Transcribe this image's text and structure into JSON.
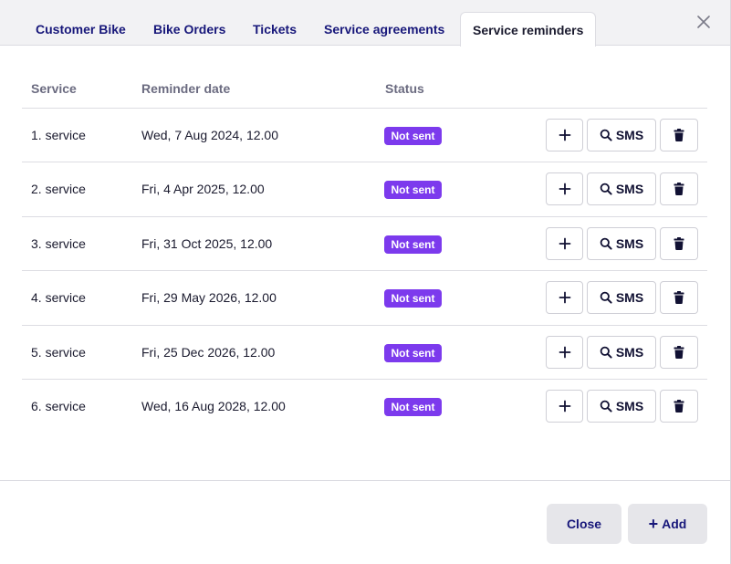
{
  "tabs": [
    {
      "label": "Customer Bike"
    },
    {
      "label": "Bike Orders"
    },
    {
      "label": "Tickets"
    },
    {
      "label": "Service agreements"
    },
    {
      "label": "Service reminders"
    }
  ],
  "active_tab": "Service reminders",
  "table": {
    "headers": {
      "service": "Service",
      "reminder_date": "Reminder date",
      "status": "Status"
    },
    "rows": [
      {
        "service": "1. service",
        "date": "Wed, 7 Aug 2024, 12.00",
        "status": "Not sent"
      },
      {
        "service": "2. service",
        "date": "Fri, 4 Apr 2025, 12.00",
        "status": "Not sent"
      },
      {
        "service": "3. service",
        "date": "Fri, 31 Oct 2025, 12.00",
        "status": "Not sent"
      },
      {
        "service": "4. service",
        "date": "Fri, 29 May 2026, 12.00",
        "status": "Not sent"
      },
      {
        "service": "5. service",
        "date": "Fri, 25 Dec 2026, 12.00",
        "status": "Not sent"
      },
      {
        "service": "6. service",
        "date": "Wed, 16 Aug 2028, 12.00",
        "status": "Not sent"
      }
    ]
  },
  "row_actions": {
    "sms_label": "SMS"
  },
  "footer": {
    "close_label": "Close",
    "add_label": "Add"
  },
  "colors": {
    "accent": "#17177a",
    "badge": "#7c3aed",
    "button_bg": "#e6e6ea"
  },
  "icons": [
    "close-icon",
    "plus-icon",
    "search-icon",
    "trash-icon"
  ]
}
